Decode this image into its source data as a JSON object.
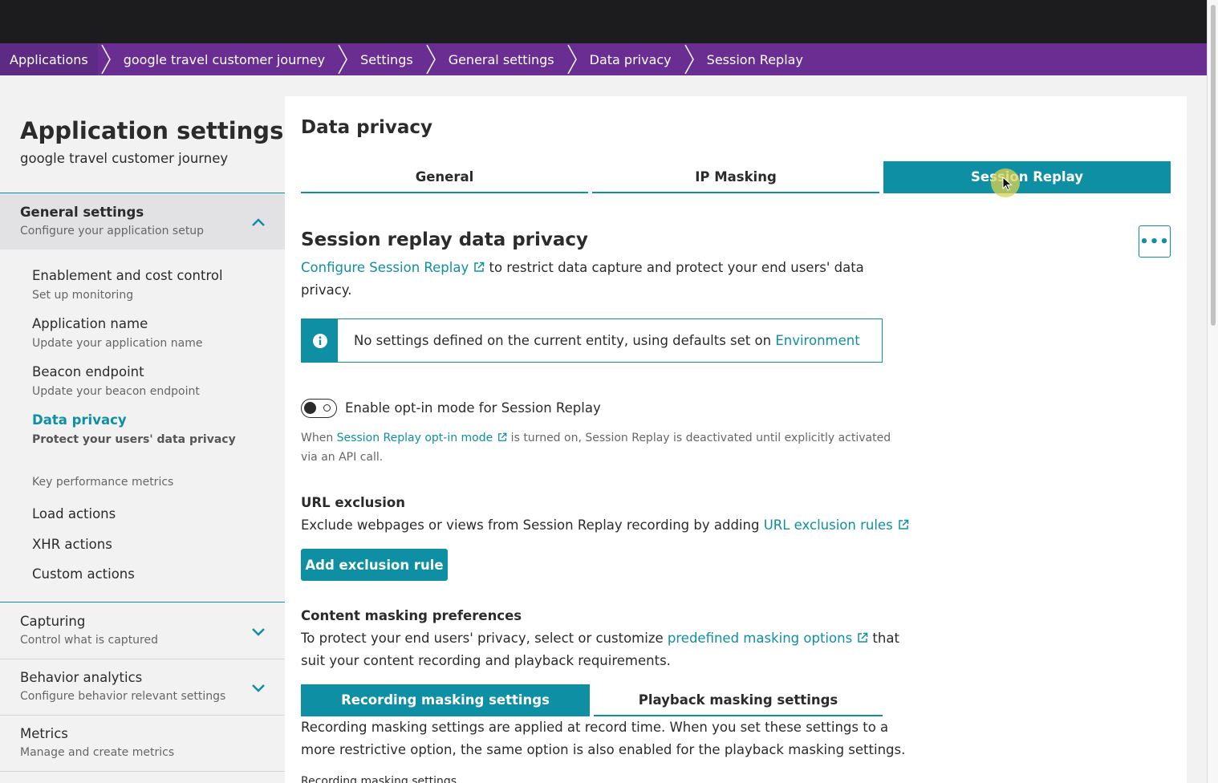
{
  "breadcrumb": [
    "Applications",
    "google travel customer journey",
    "Settings",
    "General settings",
    "Data privacy",
    "Session Replay"
  ],
  "sidebar": {
    "title": "Application settings",
    "subtitle": "google travel customer journey",
    "general": {
      "title": "General settings",
      "desc": "Configure your application setup"
    },
    "items": [
      {
        "title": "Enablement and cost control",
        "desc": "Set up monitoring"
      },
      {
        "title": "Application name",
        "desc": "Update your application name"
      },
      {
        "title": "Beacon endpoint",
        "desc": "Update your beacon endpoint"
      },
      {
        "title": "Data privacy",
        "desc": "Protect your users' data privacy"
      }
    ],
    "group_label": "Key performance metrics",
    "actions": [
      "Load actions",
      "XHR actions",
      "Custom actions"
    ],
    "capturing": {
      "title": "Capturing",
      "desc": "Control what is captured"
    },
    "behavior": {
      "title": "Behavior analytics",
      "desc": "Configure behavior relevant settings"
    },
    "metrics": {
      "title": "Metrics",
      "desc": "Manage and create metrics"
    }
  },
  "main": {
    "title": "Data privacy",
    "tabs": [
      "General",
      "IP Masking",
      "Session Replay"
    ],
    "active_tab": "Session Replay",
    "section_title": "Session replay data privacy",
    "more_label": "•••",
    "configure_link": "Configure Session Replay",
    "configure_text_1": " to restrict data capture and protect your end users' data",
    "configure_text_2": "privacy.",
    "info_text": "No settings defined on the current entity, using defaults set on ",
    "info_link": "Environment",
    "toggle_label": "Enable opt-in mode for Session Replay",
    "optin_pre": "When ",
    "optin_link": "Session Replay opt-in mode",
    "optin_post": " is turned on, Session Replay is deactivated until explicitly activated",
    "optin_line2": "via an API call.",
    "url_title": "URL exclusion",
    "url_text": "Exclude webpages or views from Session Replay recording by adding ",
    "url_link": "URL exclusion rules",
    "add_rule_button": "Add exclusion rule",
    "masking_title": "Content masking preferences",
    "masking_text_1": "To protect your end users' privacy, select or customize ",
    "masking_link": "predefined masking options",
    "masking_text_2": " that",
    "masking_text_3": "suit your content recording and playback requirements.",
    "subtabs": [
      "Recording masking settings",
      "Playback masking settings"
    ],
    "recording_text_1": "Recording masking settings are applied at record time. When you set these settings to a",
    "recording_text_2": "more restrictive option, the same option is also enabled for the playback masking settings.",
    "cut_label": "Recording masking settings"
  },
  "colors": {
    "accent": "#0e8fa3",
    "breadcrumb": "#6a2d91",
    "topbar": "#1c1c1e"
  }
}
